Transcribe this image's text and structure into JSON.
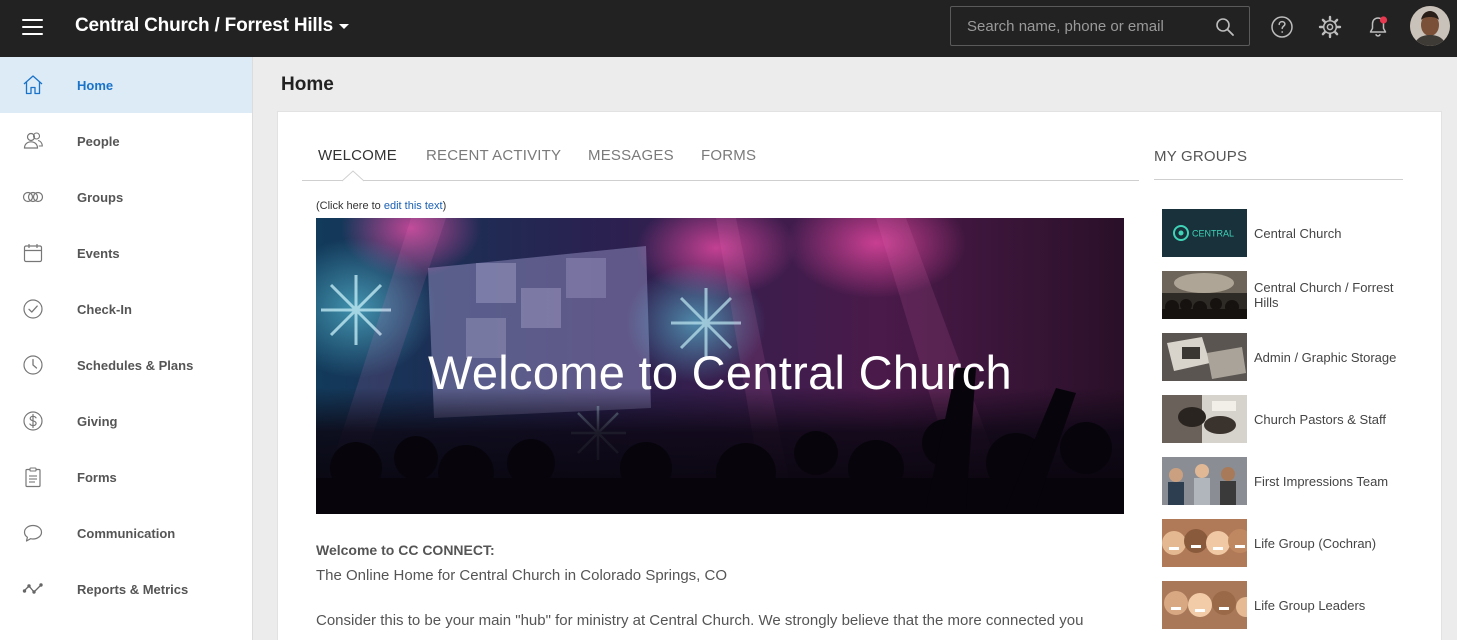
{
  "topbar": {
    "church_name": "Central Church / Forrest Hills",
    "search_placeholder": "Search name, phone or email",
    "icons": [
      "menu-icon",
      "search-icon",
      "help-icon",
      "gear-icon",
      "bell-icon"
    ],
    "notification_dot_color": "#e8384f"
  },
  "sidebar": {
    "active_color": "#1a73c8",
    "active_background": "#dcebf6",
    "items": [
      {
        "label": "Home",
        "icon": "home-icon",
        "active": true
      },
      {
        "label": "People",
        "icon": "people-icon"
      },
      {
        "label": "Groups",
        "icon": "groups-icon"
      },
      {
        "label": "Events",
        "icon": "calendar-icon"
      },
      {
        "label": "Check-In",
        "icon": "checkmark-circle-icon"
      },
      {
        "label": "Schedules & Plans",
        "icon": "clock-icon"
      },
      {
        "label": "Giving",
        "icon": "dollar-icon"
      },
      {
        "label": "Forms",
        "icon": "clipboard-icon"
      },
      {
        "label": "Communication",
        "icon": "chat-bubble-icon"
      },
      {
        "label": "Reports & Metrics",
        "icon": "line-graph-icon"
      }
    ]
  },
  "page": {
    "title": "Home"
  },
  "tabs": [
    {
      "label": "WELCOME",
      "active": true
    },
    {
      "label": "RECENT ACTIVITY"
    },
    {
      "label": "MESSAGES"
    },
    {
      "label": "FORMS"
    }
  ],
  "welcome": {
    "edit_prefix": "(Click here to ",
    "edit_link": "edit this text",
    "edit_suffix": ")",
    "banner_text": "Welcome to Central Church",
    "heading": "Welcome to CC CONNECT:",
    "subheading": "The Online Home for Central Church in Colorado Springs, CO",
    "body": "Consider this to be your main \"hub\" for ministry at Central Church. We strongly believe that the more connected you"
  },
  "my_groups": {
    "title": "MY GROUPS",
    "logo_text": "CENTRAL",
    "groups": [
      {
        "name": "Central Church"
      },
      {
        "name": "Central Church / Forrest Hills"
      },
      {
        "name": "Admin / Graphic Storage"
      },
      {
        "name": "Church Pastors & Staff"
      },
      {
        "name": "First Impressions Team"
      },
      {
        "name": "Life Group (Cochran)"
      },
      {
        "name": "Life Group Leaders"
      }
    ]
  }
}
